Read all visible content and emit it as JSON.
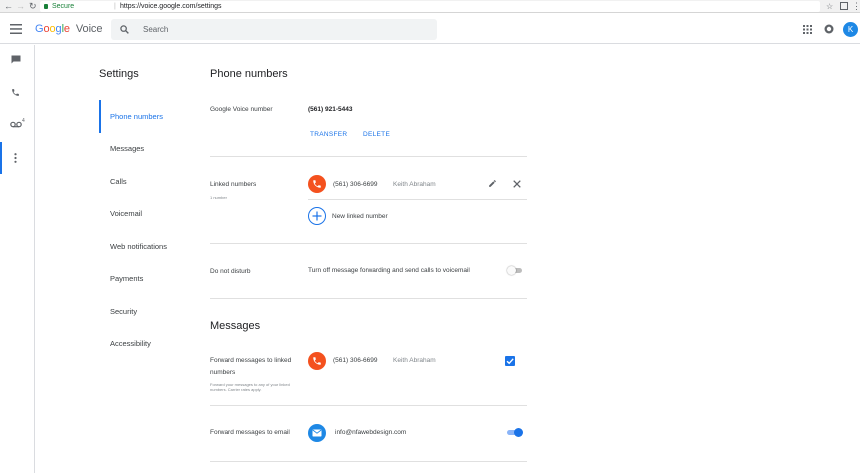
{
  "browser": {
    "secure_label": "Secure",
    "url": "https://voice.google.com/settings"
  },
  "header": {
    "logo_google": "Google",
    "logo_voice": "Voice",
    "search_placeholder": "Search",
    "avatar_initial": "K"
  },
  "rail": {
    "voicemail_badge": "4"
  },
  "settings_nav": {
    "title": "Settings",
    "items": [
      {
        "label": "Phone numbers",
        "active": true
      },
      {
        "label": "Messages"
      },
      {
        "label": "Calls"
      },
      {
        "label": "Voicemail"
      },
      {
        "label": "Web notifications"
      },
      {
        "label": "Payments"
      },
      {
        "label": "Security"
      },
      {
        "label": "Accessibility"
      }
    ]
  },
  "phone_numbers": {
    "title": "Phone numbers",
    "gv_label": "Google Voice number",
    "gv_number": "(561) 921-5443",
    "transfer": "TRANSFER",
    "delete": "DELETE",
    "linked_label": "Linked numbers",
    "linked_count": "1 number",
    "linked_number": "(561) 306-6699",
    "linked_name": "Keith Abraham",
    "new_linked": "New linked number",
    "dnd_label": "Do not disturb",
    "dnd_desc": "Turn off message forwarding and send calls to voicemail",
    "dnd_on": false
  },
  "messages": {
    "title": "Messages",
    "forward_label_1": "Forward messages to linked",
    "forward_label_2": "numbers",
    "forward_sub_1": "Forward your messages to any of your linked",
    "forward_sub_2": "numbers. Carrier rates apply.",
    "forward_number": "(561) 306-6699",
    "forward_name": "Keith Abraham",
    "forward_checked": true,
    "email_label": "Forward messages to email",
    "email": "info@nfawebdesign.com",
    "email_on": true
  },
  "colors": {
    "accent": "#1a73e8",
    "phone": "#f4511e",
    "mail": "#1e88e5"
  }
}
